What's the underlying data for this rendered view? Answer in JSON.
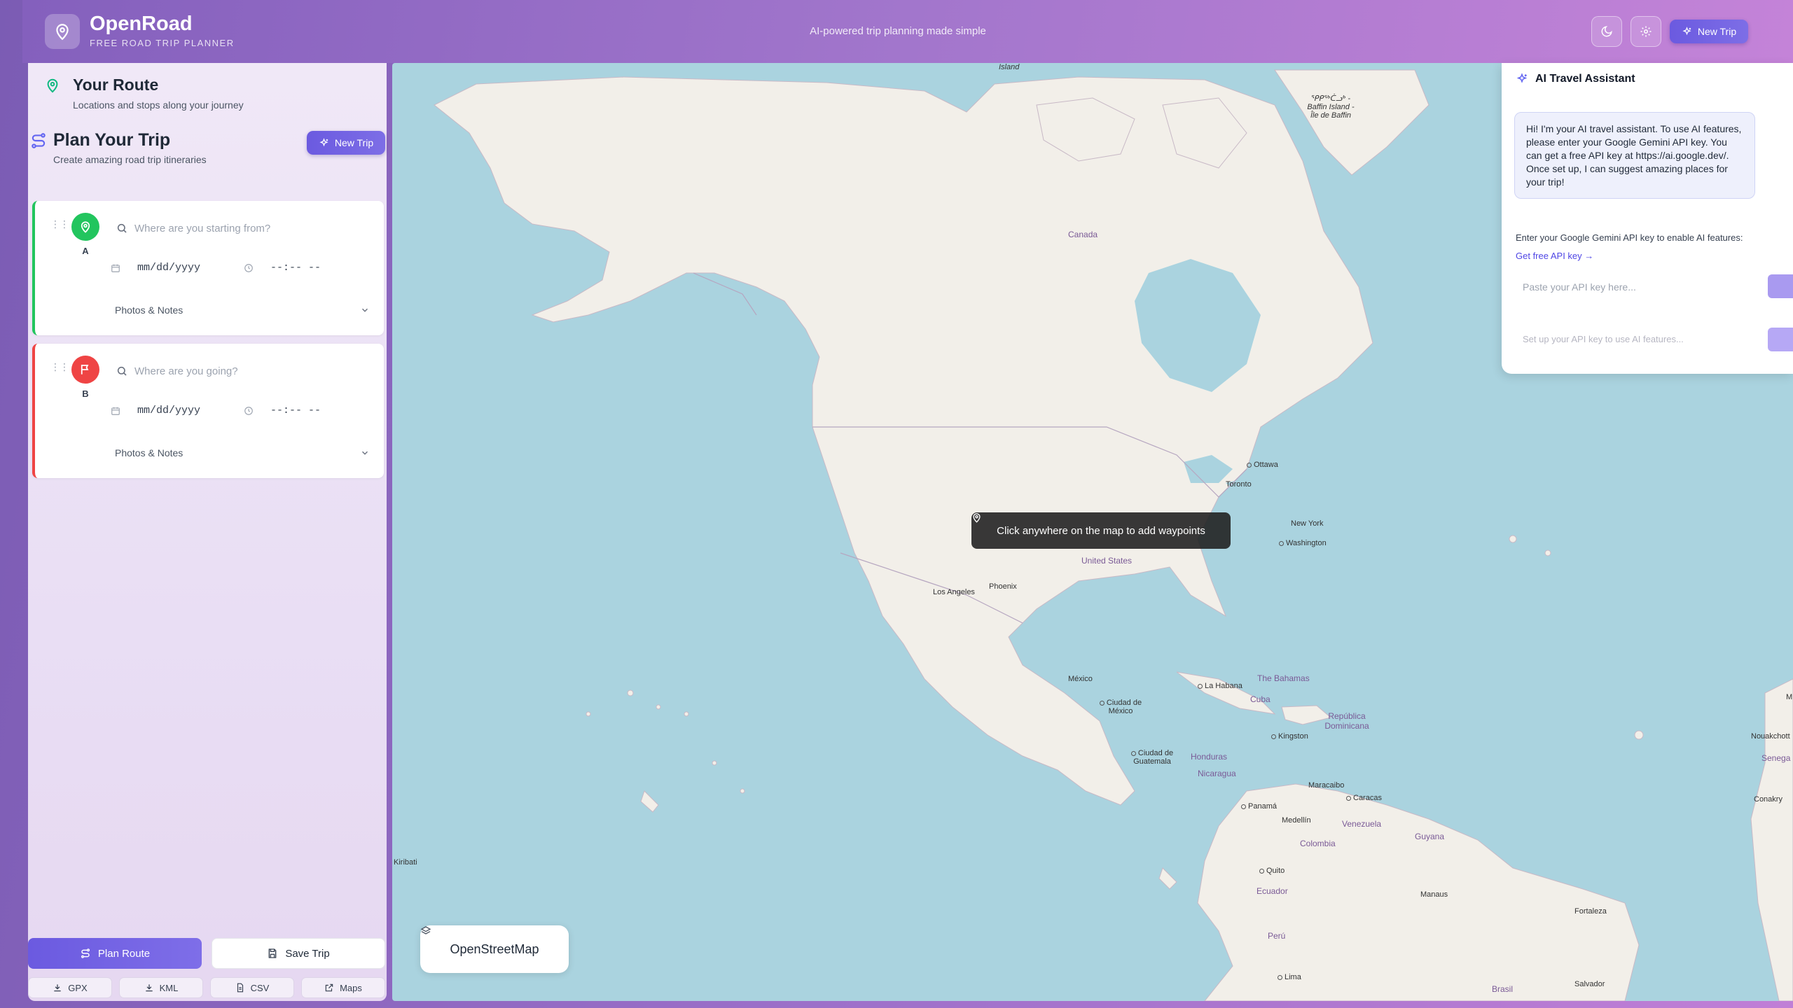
{
  "header": {
    "brand": "OpenRoad",
    "subtitle": "FREE ROAD TRIP PLANNER",
    "tagline": "AI-powered trip planning made simple",
    "new_trip_label": "New Trip",
    "theme_icon": "moon-icon",
    "settings_icon": "gear-icon"
  },
  "sidebar": {
    "route_title": "Your Route",
    "route_subtitle": "Locations and stops along your journey",
    "plan_title": "Plan Your Trip",
    "plan_subtitle": "Create amazing road trip itineraries",
    "new_trip_label": "New Trip",
    "waypoints": [
      {
        "letter": "A",
        "placeholder": "Where are you starting from?",
        "date_placeholder": "mm/dd/yyyy",
        "time_placeholder": "--:-- --",
        "notes_label": "Photos & Notes",
        "color": "#22c55e"
      },
      {
        "letter": "B",
        "placeholder": "Where are you going?",
        "date_placeholder": "mm/dd/yyyy",
        "time_placeholder": "--:-- --",
        "notes_label": "Photos & Notes",
        "color": "#ef4444"
      }
    ],
    "plan_route_label": "Plan Route",
    "save_trip_label": "Save Trip",
    "exports": [
      "GPX",
      "KML",
      "CSV",
      "Maps"
    ]
  },
  "map": {
    "hint": "Click anywhere on the map to add waypoints",
    "layer_label": "OpenStreetMap",
    "labels": {
      "canada": "Canada",
      "united_states": "United States",
      "mexico": "México",
      "ottawa": "Ottawa",
      "toronto": "Toronto",
      "new_york": "New York",
      "washington": "Washington",
      "los_angeles": "Los Angeles",
      "phoenix": "Phoenix",
      "ciudad_mexico": "Ciudad de México",
      "la_habana": "La Habana",
      "cuba": "Cuba",
      "bahamas": "The Bahamas",
      "kingston": "Kingston",
      "republica_dominicana": "República Dominicana",
      "guatemala": "Ciudad de Guatemala",
      "honduras": "Honduras",
      "nicaragua": "Nicaragua",
      "panama": "Panamá",
      "maracaibo": "Maracaibo",
      "caracas": "Caracas",
      "venezuela": "Venezuela",
      "medellin": "Medellín",
      "colombia": "Colombia",
      "guyana": "Guyana",
      "quito": "Quito",
      "ecuador": "Ecuador",
      "manaus": "Manaus",
      "fortaleza": "Fortaleza",
      "peru": "Perú",
      "brasil": "Brasil",
      "lima": "Lima",
      "salvador": "Salvador",
      "kiribati": "Kiribati",
      "baffin": "ᕿᑭᖅᑖᓗᒃ - Baffin Island - Île de Baffin",
      "island_top": "Island",
      "nouakchott": "Nouakchott",
      "senegal": "Senega",
      "conakry": "Conakry",
      "mali": "M"
    }
  },
  "ai": {
    "title": "AI Travel Assistant",
    "message": "Hi! I'm your AI travel assistant. To use AI features, please enter your Google Gemini API key. You can get a free API key at https://ai.google.dev/. Once set up, I can suggest amazing places for your trip!",
    "prompt": "Enter your Google Gemini API key to enable AI features:",
    "link": "Get free API key →",
    "key_placeholder": "Paste your API key here...",
    "chat_placeholder": "Set up your API key to use AI features..."
  }
}
